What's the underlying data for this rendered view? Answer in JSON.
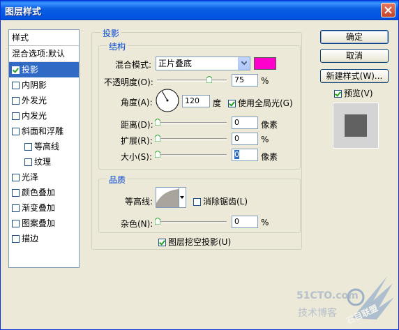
{
  "window": {
    "title": "图层样式"
  },
  "stylelist": {
    "header": "样式",
    "items": [
      {
        "label": "混合选项:默认",
        "checkbox": false,
        "checked": false,
        "selected": false,
        "indent": false
      },
      {
        "label": "投影",
        "checkbox": true,
        "checked": true,
        "selected": true,
        "indent": false
      },
      {
        "label": "内阴影",
        "checkbox": true,
        "checked": false,
        "selected": false,
        "indent": false
      },
      {
        "label": "外发光",
        "checkbox": true,
        "checked": false,
        "selected": false,
        "indent": false
      },
      {
        "label": "内发光",
        "checkbox": true,
        "checked": false,
        "selected": false,
        "indent": false
      },
      {
        "label": "斜面和浮雕",
        "checkbox": true,
        "checked": false,
        "selected": false,
        "indent": false
      },
      {
        "label": "等高线",
        "checkbox": true,
        "checked": false,
        "selected": false,
        "indent": true
      },
      {
        "label": "纹理",
        "checkbox": true,
        "checked": false,
        "selected": false,
        "indent": true
      },
      {
        "label": "光泽",
        "checkbox": true,
        "checked": false,
        "selected": false,
        "indent": false
      },
      {
        "label": "颜色叠加",
        "checkbox": true,
        "checked": false,
        "selected": false,
        "indent": false
      },
      {
        "label": "渐变叠加",
        "checkbox": true,
        "checked": false,
        "selected": false,
        "indent": false
      },
      {
        "label": "图案叠加",
        "checkbox": true,
        "checked": false,
        "selected": false,
        "indent": false
      },
      {
        "label": "描边",
        "checkbox": true,
        "checked": false,
        "selected": false,
        "indent": false
      }
    ]
  },
  "dropshadow": {
    "section_title": "投影",
    "structure_title": "结构",
    "blend_mode_label": "混合模式:",
    "blend_mode_value": "正片叠底",
    "shadow_color": "#ff00cc",
    "opacity_label": "不透明度(O):",
    "opacity_value": "75",
    "opacity_unit": "%",
    "opacity_level": 0.75,
    "angle_label": "角度(A):",
    "angle_value": "120",
    "angle_unit": "度",
    "global_light_label": "使用全局光(G)",
    "global_light_checked": true,
    "distance_label": "距离(D):",
    "distance_value": "0",
    "distance_unit": "像素",
    "spread_label": "扩展(R):",
    "spread_value": "0",
    "spread_unit": "%",
    "size_label": "大小(S):",
    "size_value": "0",
    "size_unit": "像素",
    "quality_title": "品质",
    "contour_label": "等高线:",
    "antialias_label": "消除锯齿(L)",
    "antialias_checked": false,
    "noise_label": "杂色(N):",
    "noise_value": "0",
    "noise_unit": "%",
    "knockout_label": "图层挖空投影(U)",
    "knockout_checked": true
  },
  "buttons": {
    "ok": "确定",
    "cancel": "取消",
    "new_style": "新建样式(W)...",
    "preview_label": "预览(V)",
    "preview_checked": true
  },
  "watermark": {
    "line1": "51CTO.com",
    "line2": "技术博客",
    "brand": "石目联盟"
  }
}
